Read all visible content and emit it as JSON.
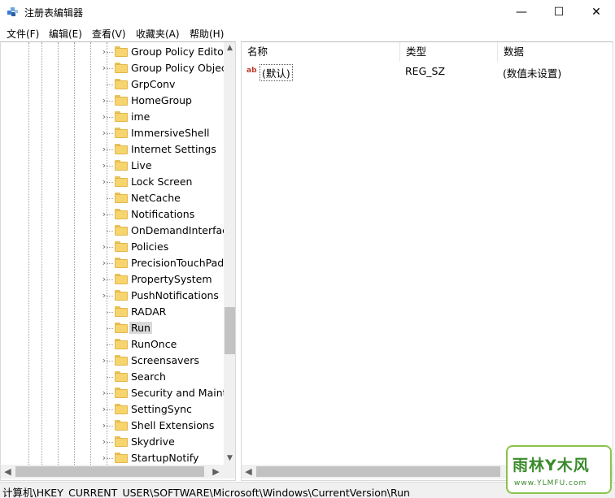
{
  "window": {
    "title": "注册表编辑器",
    "minimize_glyph": "—",
    "maximize_glyph": "☐",
    "close_glyph": "✕"
  },
  "menu": [
    "文件(F)",
    "编辑(E)",
    "查看(V)",
    "收藏夹(A)",
    "帮助(H)"
  ],
  "tree": {
    "items": [
      {
        "label": "Group Policy Editor",
        "expandable": true
      },
      {
        "label": "Group Policy Objects",
        "expandable": true
      },
      {
        "label": "GrpConv",
        "expandable": false
      },
      {
        "label": "HomeGroup",
        "expandable": true
      },
      {
        "label": "ime",
        "expandable": true
      },
      {
        "label": "ImmersiveShell",
        "expandable": true
      },
      {
        "label": "Internet Settings",
        "expandable": true
      },
      {
        "label": "Live",
        "expandable": true
      },
      {
        "label": "Lock Screen",
        "expandable": true
      },
      {
        "label": "NetCache",
        "expandable": false
      },
      {
        "label": "Notifications",
        "expandable": true
      },
      {
        "label": "OnDemandInterfaceCache",
        "expandable": false
      },
      {
        "label": "Policies",
        "expandable": true
      },
      {
        "label": "PrecisionTouchPad",
        "expandable": true
      },
      {
        "label": "PropertySystem",
        "expandable": true
      },
      {
        "label": "PushNotifications",
        "expandable": true
      },
      {
        "label": "RADAR",
        "expandable": false
      },
      {
        "label": "Run",
        "expandable": false,
        "selected": true
      },
      {
        "label": "RunOnce",
        "expandable": false
      },
      {
        "label": "Screensavers",
        "expandable": true
      },
      {
        "label": "Search",
        "expandable": false
      },
      {
        "label": "Security and Maintenance",
        "expandable": true
      },
      {
        "label": "SettingSync",
        "expandable": true
      },
      {
        "label": "Shell Extensions",
        "expandable": true
      },
      {
        "label": "Skydrive",
        "expandable": true
      },
      {
        "label": "StartupNotify",
        "expandable": true
      }
    ]
  },
  "values_pane": {
    "columns": [
      "名称",
      "类型",
      "数据"
    ],
    "rows": [
      {
        "icon": "ab",
        "name": "(默认)",
        "type": "REG_SZ",
        "data": "(数值未设置)"
      }
    ]
  },
  "scroll_glyphs": {
    "up": "▲",
    "down": "▼",
    "left": "◀",
    "right": "▶",
    "expander": "›"
  },
  "status": {
    "path": "计算机\\HKEY_CURRENT_USER\\SOFTWARE\\Microsoft\\Windows\\CurrentVersion\\Run"
  },
  "watermark": {
    "text": "雨林Y木风",
    "url": "www.YLMFU.com"
  }
}
